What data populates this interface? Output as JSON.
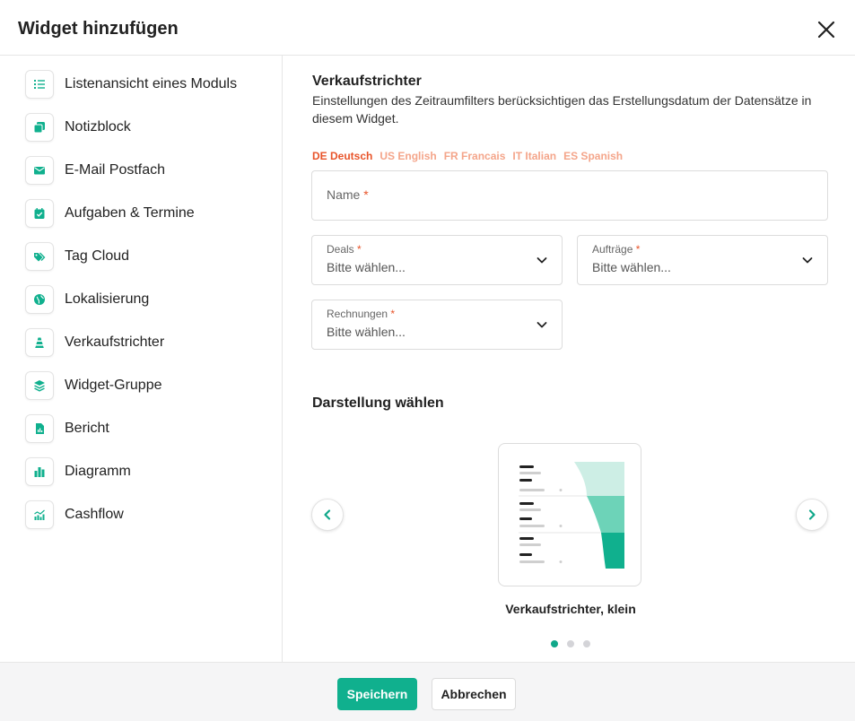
{
  "dialog": {
    "title": "Widget hinzufügen"
  },
  "sidebar": {
    "items": [
      {
        "label": "Listenansicht eines Moduls",
        "icon": "list-icon"
      },
      {
        "label": "Notizblock",
        "icon": "notes-icon"
      },
      {
        "label": "E-Mail Postfach",
        "icon": "mail-icon"
      },
      {
        "label": "Aufgaben & Termine",
        "icon": "calendar-check-icon"
      },
      {
        "label": "Tag Cloud",
        "icon": "tags-icon"
      },
      {
        "label": "Lokalisierung",
        "icon": "globe-icon"
      },
      {
        "label": "Verkaufstrichter",
        "icon": "funnel-icon"
      },
      {
        "label": "Widget-Gruppe",
        "icon": "layers-icon"
      },
      {
        "label": "Bericht",
        "icon": "report-file-icon"
      },
      {
        "label": "Diagramm",
        "icon": "bar-chart-icon"
      },
      {
        "label": "Cashflow",
        "icon": "cashflow-chart-icon"
      }
    ]
  },
  "main": {
    "title": "Verkaufstrichter",
    "description": "Einstellungen des Zeitraumfilters berücksichtigen das Erstellungsdatum der Datensätze in diesem Widget.",
    "languages": [
      {
        "label": "DE Deutsch",
        "active": true
      },
      {
        "label": "US English",
        "active": false
      },
      {
        "label": "FR Francais",
        "active": false
      },
      {
        "label": "IT Italian",
        "active": false
      },
      {
        "label": "ES Spanish",
        "active": false
      }
    ],
    "name_field": {
      "label": "Name",
      "required_mark": "*"
    },
    "deals": {
      "label": "Deals",
      "required_mark": "*",
      "placeholder": "Bitte wählen..."
    },
    "auftraege": {
      "label": "Aufträge",
      "required_mark": "*",
      "placeholder": "Bitte wählen..."
    },
    "rechnungen": {
      "label": "Rechnungen",
      "required_mark": "*",
      "placeholder": "Bitte wählen..."
    },
    "display_title": "Darstellung wählen",
    "preview_label": "Verkaufstrichter, klein",
    "carousel_active_index": 0,
    "carousel_count": 3
  },
  "footer": {
    "save_label": "Speichern",
    "cancel_label": "Abbrechen"
  },
  "colors": {
    "accent": "#10b08e",
    "required": "#e8542a",
    "lang_active": "#e8542a",
    "lang_inactive": "#f4a58a"
  }
}
